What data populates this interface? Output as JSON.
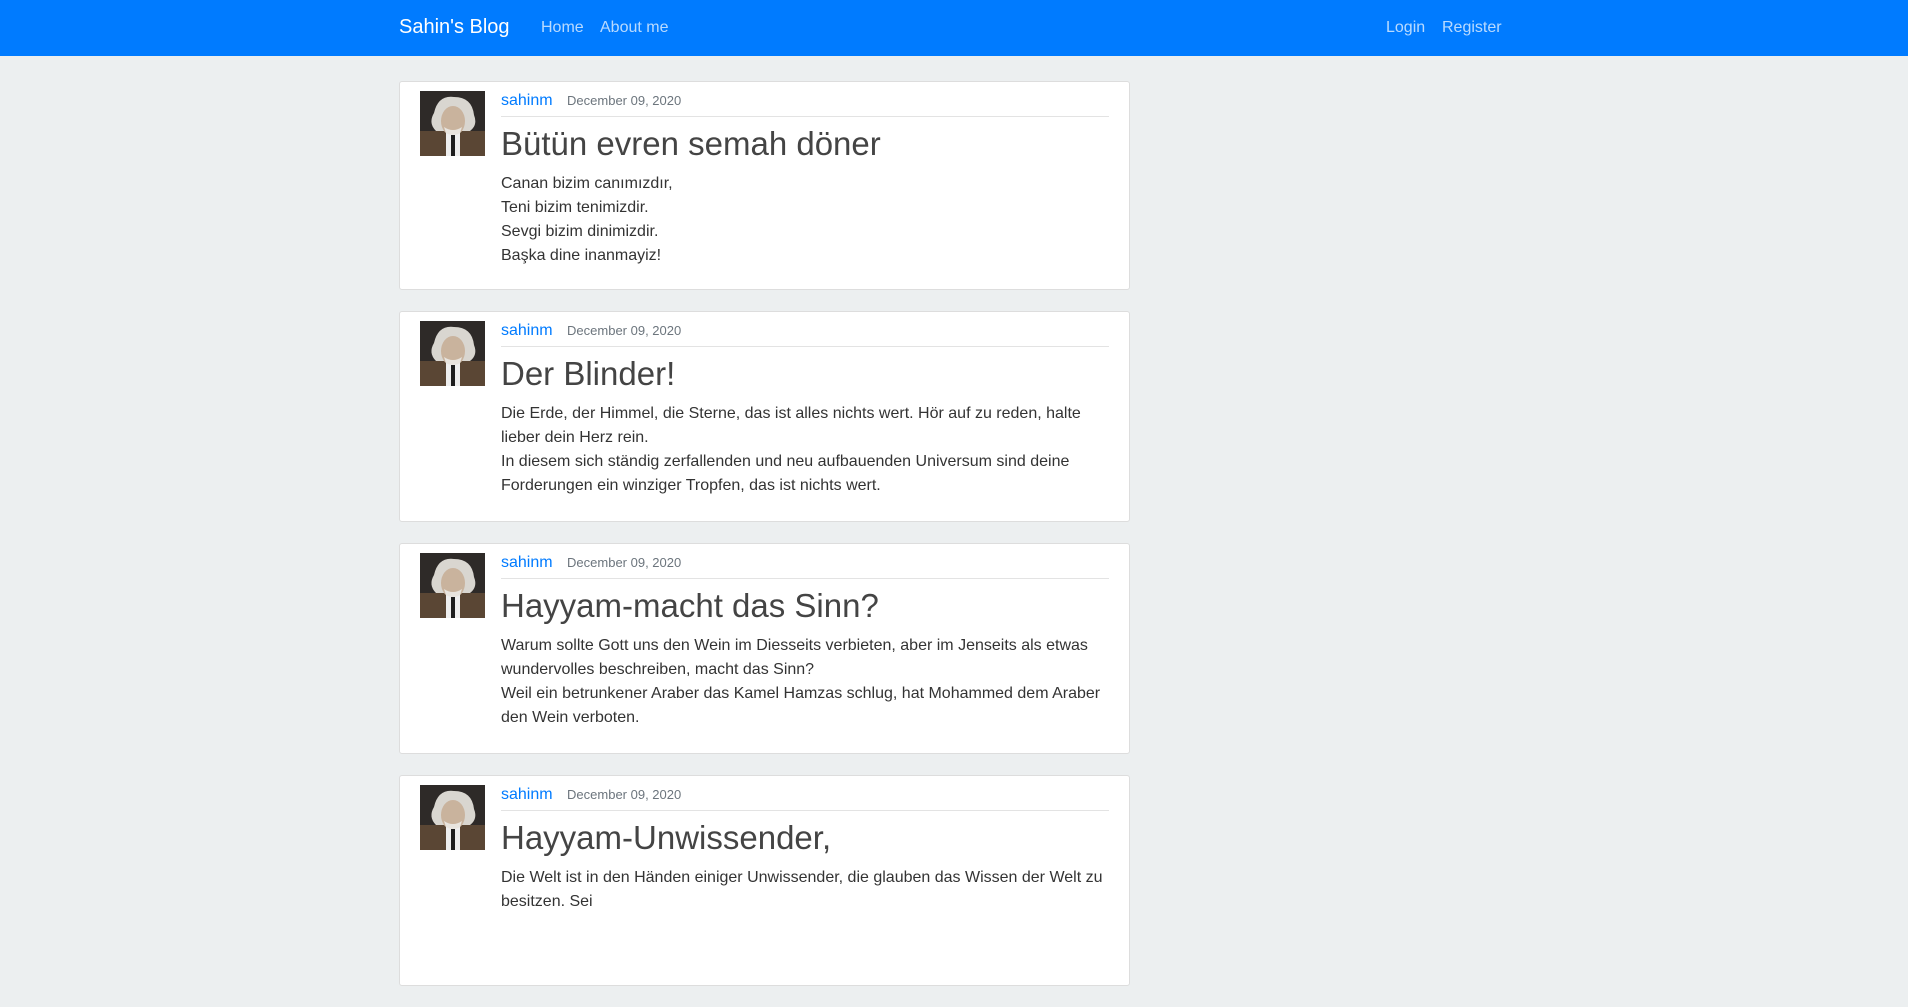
{
  "navbar": {
    "brand": "Sahin's Blog",
    "links_left": [
      "Home",
      "About me"
    ],
    "links_right": [
      "Login",
      "Register"
    ]
  },
  "posts": [
    {
      "author": "sahinm",
      "date": "December 09, 2020",
      "title": "Bütün evren semah döner",
      "content": "Canan bizim canımızdır,\nTeni bizim tenimizdir.\nSevgi bizim dinimizdir.\nBaşka dine inanmayiz!"
    },
    {
      "author": "sahinm",
      "date": "December 09, 2020",
      "title": "Der Blinder!",
      "content": "Die Erde, der Himmel, die Sterne, das ist alles nichts wert. Hör auf zu reden, halte lieber dein Herz rein.\nIn diesem sich ständig zerfallenden und neu aufbauenden Universum sind deine Forderungen ein winziger Tropfen, das ist nichts wert."
    },
    {
      "author": "sahinm",
      "date": "December 09, 2020",
      "title": "Hayyam-macht das Sinn?",
      "content": "Warum sollte Gott uns den Wein im Diesseits verbieten, aber im Jenseits als etwas wundervolles beschreiben, macht das Sinn?\nWeil ein betrunkener Araber das Kamel Hamzas schlug, hat Mohammed dem Araber den Wein verboten."
    },
    {
      "author": "sahinm",
      "date": "December 09, 2020",
      "title": "Hayyam-Unwissender,",
      "content": "Die Welt ist in den Händen einiger Unwissender, die glauben das Wissen der Welt zu besitzen. Sei"
    }
  ]
}
